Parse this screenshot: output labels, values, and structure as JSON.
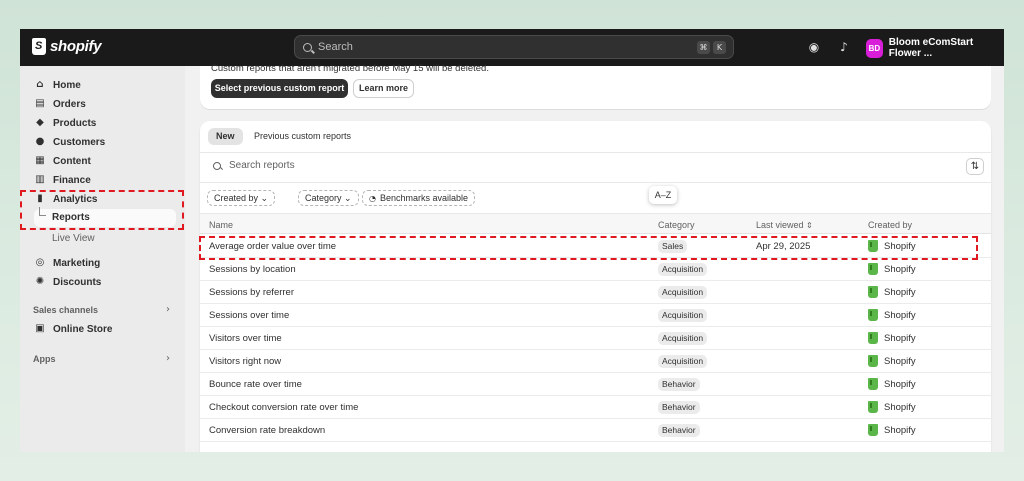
{
  "topbar": {
    "logo_text": "shopify",
    "search_placeholder": "Search",
    "shortcut_keys": [
      "⌘",
      "K"
    ],
    "store_avatar": "BD",
    "store_name": "Bloom eComStart Flower ...",
    "avatar_color": "#d91ed9"
  },
  "sidebar": {
    "items": [
      {
        "label": "Home",
        "icon": "home-icon",
        "glyph": "⌂"
      },
      {
        "label": "Orders",
        "icon": "inbox-icon",
        "glyph": "▤"
      },
      {
        "label": "Products",
        "icon": "tag-icon",
        "glyph": "◆"
      },
      {
        "label": "Customers",
        "icon": "person-icon",
        "glyph": "●"
      },
      {
        "label": "Content",
        "icon": "content-icon",
        "glyph": "▦"
      },
      {
        "label": "Finance",
        "icon": "bank-icon",
        "glyph": "▥"
      },
      {
        "label": "Analytics",
        "icon": "bar-chart-icon",
        "glyph": "▮"
      }
    ],
    "sub_reports": "Reports",
    "sub_live_view": "Live View",
    "items2": [
      {
        "label": "Marketing",
        "icon": "target-icon",
        "glyph": "◎"
      },
      {
        "label": "Discounts",
        "icon": "discount-icon",
        "glyph": "✺"
      }
    ],
    "section_sales": "Sales channels",
    "online_store": "Online Store",
    "section_apps": "Apps"
  },
  "notice": {
    "text": "Custom reports that aren't migrated before May 15 will be deleted.",
    "primary_button": "Select previous custom report",
    "secondary_button": "Learn more"
  },
  "reports": {
    "tabs": [
      "New",
      "Previous custom reports"
    ],
    "search_placeholder": "Search reports",
    "filters": [
      "Created by ⌄",
      "Category ⌄",
      "Benchmarks available"
    ],
    "tooltip": "A–Z",
    "columns": {
      "name": "Name",
      "category": "Category",
      "last_viewed": "Last viewed",
      "created_by": "Created by"
    },
    "rows": [
      {
        "name": "Average order value over time",
        "category": "Sales",
        "last_viewed": "Apr 29, 2025",
        "created_by": "Shopify"
      },
      {
        "name": "Sessions by location",
        "category": "Acquisition",
        "last_viewed": "",
        "created_by": "Shopify"
      },
      {
        "name": "Sessions by referrer",
        "category": "Acquisition",
        "last_viewed": "",
        "created_by": "Shopify"
      },
      {
        "name": "Sessions over time",
        "category": "Acquisition",
        "last_viewed": "",
        "created_by": "Shopify"
      },
      {
        "name": "Visitors over time",
        "category": "Acquisition",
        "last_viewed": "",
        "created_by": "Shopify"
      },
      {
        "name": "Visitors right now",
        "category": "Acquisition",
        "last_viewed": "",
        "created_by": "Shopify"
      },
      {
        "name": "Bounce rate over time",
        "category": "Behavior",
        "last_viewed": "",
        "created_by": "Shopify"
      },
      {
        "name": "Checkout conversion rate over time",
        "category": "Behavior",
        "last_viewed": "",
        "created_by": "Shopify"
      },
      {
        "name": "Conversion rate breakdown",
        "category": "Behavior",
        "last_viewed": "",
        "created_by": "Shopify"
      }
    ]
  },
  "colors": {
    "highlight": "#e0181f",
    "topbar": "#1a1a1a",
    "shopify_green": "#5bb64a"
  }
}
